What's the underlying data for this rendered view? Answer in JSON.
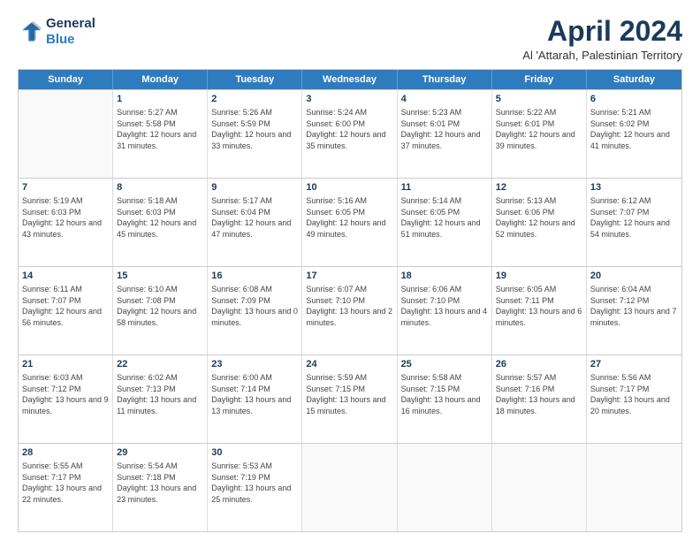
{
  "header": {
    "logo_line1": "General",
    "logo_line2": "Blue",
    "title": "April 2024",
    "subtitle": "Al 'Attarah, Palestinian Territory"
  },
  "calendar": {
    "days_of_week": [
      "Sunday",
      "Monday",
      "Tuesday",
      "Wednesday",
      "Thursday",
      "Friday",
      "Saturday"
    ],
    "weeks": [
      [
        {
          "day": "",
          "sunrise": "",
          "sunset": "",
          "daylight": ""
        },
        {
          "day": "1",
          "sunrise": "Sunrise: 5:27 AM",
          "sunset": "Sunset: 5:58 PM",
          "daylight": "Daylight: 12 hours and 31 minutes."
        },
        {
          "day": "2",
          "sunrise": "Sunrise: 5:26 AM",
          "sunset": "Sunset: 5:59 PM",
          "daylight": "Daylight: 12 hours and 33 minutes."
        },
        {
          "day": "3",
          "sunrise": "Sunrise: 5:24 AM",
          "sunset": "Sunset: 6:00 PM",
          "daylight": "Daylight: 12 hours and 35 minutes."
        },
        {
          "day": "4",
          "sunrise": "Sunrise: 5:23 AM",
          "sunset": "Sunset: 6:01 PM",
          "daylight": "Daylight: 12 hours and 37 minutes."
        },
        {
          "day": "5",
          "sunrise": "Sunrise: 5:22 AM",
          "sunset": "Sunset: 6:01 PM",
          "daylight": "Daylight: 12 hours and 39 minutes."
        },
        {
          "day": "6",
          "sunrise": "Sunrise: 5:21 AM",
          "sunset": "Sunset: 6:02 PM",
          "daylight": "Daylight: 12 hours and 41 minutes."
        }
      ],
      [
        {
          "day": "7",
          "sunrise": "Sunrise: 5:19 AM",
          "sunset": "Sunset: 6:03 PM",
          "daylight": "Daylight: 12 hours and 43 minutes."
        },
        {
          "day": "8",
          "sunrise": "Sunrise: 5:18 AM",
          "sunset": "Sunset: 6:03 PM",
          "daylight": "Daylight: 12 hours and 45 minutes."
        },
        {
          "day": "9",
          "sunrise": "Sunrise: 5:17 AM",
          "sunset": "Sunset: 6:04 PM",
          "daylight": "Daylight: 12 hours and 47 minutes."
        },
        {
          "day": "10",
          "sunrise": "Sunrise: 5:16 AM",
          "sunset": "Sunset: 6:05 PM",
          "daylight": "Daylight: 12 hours and 49 minutes."
        },
        {
          "day": "11",
          "sunrise": "Sunrise: 5:14 AM",
          "sunset": "Sunset: 6:05 PM",
          "daylight": "Daylight: 12 hours and 51 minutes."
        },
        {
          "day": "12",
          "sunrise": "Sunrise: 5:13 AM",
          "sunset": "Sunset: 6:06 PM",
          "daylight": "Daylight: 12 hours and 52 minutes."
        },
        {
          "day": "13",
          "sunrise": "Sunrise: 6:12 AM",
          "sunset": "Sunset: 7:07 PM",
          "daylight": "Daylight: 12 hours and 54 minutes."
        }
      ],
      [
        {
          "day": "14",
          "sunrise": "Sunrise: 6:11 AM",
          "sunset": "Sunset: 7:07 PM",
          "daylight": "Daylight: 12 hours and 56 minutes."
        },
        {
          "day": "15",
          "sunrise": "Sunrise: 6:10 AM",
          "sunset": "Sunset: 7:08 PM",
          "daylight": "Daylight: 12 hours and 58 minutes."
        },
        {
          "day": "16",
          "sunrise": "Sunrise: 6:08 AM",
          "sunset": "Sunset: 7:09 PM",
          "daylight": "Daylight: 13 hours and 0 minutes."
        },
        {
          "day": "17",
          "sunrise": "Sunrise: 6:07 AM",
          "sunset": "Sunset: 7:10 PM",
          "daylight": "Daylight: 13 hours and 2 minutes."
        },
        {
          "day": "18",
          "sunrise": "Sunrise: 6:06 AM",
          "sunset": "Sunset: 7:10 PM",
          "daylight": "Daylight: 13 hours and 4 minutes."
        },
        {
          "day": "19",
          "sunrise": "Sunrise: 6:05 AM",
          "sunset": "Sunset: 7:11 PM",
          "daylight": "Daylight: 13 hours and 6 minutes."
        },
        {
          "day": "20",
          "sunrise": "Sunrise: 6:04 AM",
          "sunset": "Sunset: 7:12 PM",
          "daylight": "Daylight: 13 hours and 7 minutes."
        }
      ],
      [
        {
          "day": "21",
          "sunrise": "Sunrise: 6:03 AM",
          "sunset": "Sunset: 7:12 PM",
          "daylight": "Daylight: 13 hours and 9 minutes."
        },
        {
          "day": "22",
          "sunrise": "Sunrise: 6:02 AM",
          "sunset": "Sunset: 7:13 PM",
          "daylight": "Daylight: 13 hours and 11 minutes."
        },
        {
          "day": "23",
          "sunrise": "Sunrise: 6:00 AM",
          "sunset": "Sunset: 7:14 PM",
          "daylight": "Daylight: 13 hours and 13 minutes."
        },
        {
          "day": "24",
          "sunrise": "Sunrise: 5:59 AM",
          "sunset": "Sunset: 7:15 PM",
          "daylight": "Daylight: 13 hours and 15 minutes."
        },
        {
          "day": "25",
          "sunrise": "Sunrise: 5:58 AM",
          "sunset": "Sunset: 7:15 PM",
          "daylight": "Daylight: 13 hours and 16 minutes."
        },
        {
          "day": "26",
          "sunrise": "Sunrise: 5:57 AM",
          "sunset": "Sunset: 7:16 PM",
          "daylight": "Daylight: 13 hours and 18 minutes."
        },
        {
          "day": "27",
          "sunrise": "Sunrise: 5:56 AM",
          "sunset": "Sunset: 7:17 PM",
          "daylight": "Daylight: 13 hours and 20 minutes."
        }
      ],
      [
        {
          "day": "28",
          "sunrise": "Sunrise: 5:55 AM",
          "sunset": "Sunset: 7:17 PM",
          "daylight": "Daylight: 13 hours and 22 minutes."
        },
        {
          "day": "29",
          "sunrise": "Sunrise: 5:54 AM",
          "sunset": "Sunset: 7:18 PM",
          "daylight": "Daylight: 13 hours and 23 minutes."
        },
        {
          "day": "30",
          "sunrise": "Sunrise: 5:53 AM",
          "sunset": "Sunset: 7:19 PM",
          "daylight": "Daylight: 13 hours and 25 minutes."
        },
        {
          "day": "",
          "sunrise": "",
          "sunset": "",
          "daylight": ""
        },
        {
          "day": "",
          "sunrise": "",
          "sunset": "",
          "daylight": ""
        },
        {
          "day": "",
          "sunrise": "",
          "sunset": "",
          "daylight": ""
        },
        {
          "day": "",
          "sunrise": "",
          "sunset": "",
          "daylight": ""
        }
      ]
    ]
  }
}
